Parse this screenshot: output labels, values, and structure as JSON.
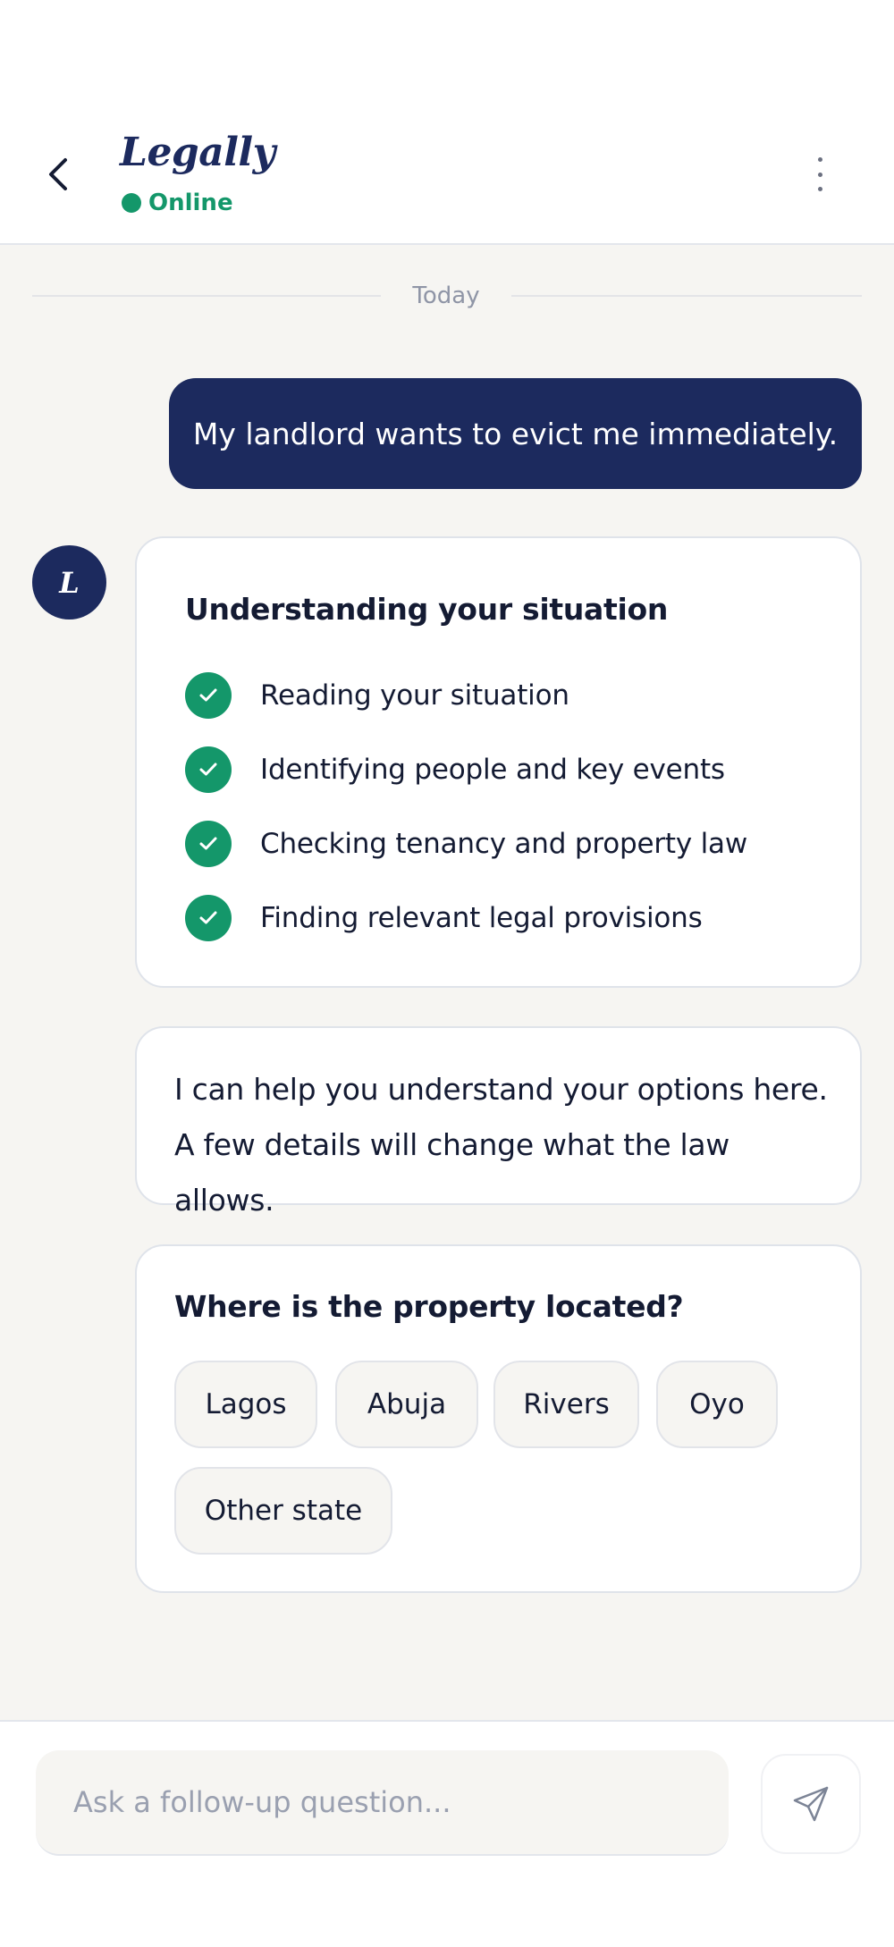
{
  "header": {
    "title": "Legally",
    "status": "Online",
    "back_icon": "chevron-left-icon",
    "menu_icon": "more-vertical-icon"
  },
  "chat": {
    "date_label": "Today",
    "user_message": "My landlord wants to evict me immediately.",
    "avatar_letter": "L",
    "analysis": {
      "title": "Understanding your situation",
      "steps": [
        "Reading your situation",
        "Identifying people and key events",
        "Checking tenancy and property law",
        "Finding relevant legal provisions"
      ]
    },
    "reply_lines": [
      "I can help you understand your options here.",
      "A few details will change what the law allows."
    ],
    "question": {
      "title": "Where is the property located?",
      "options": [
        "Lagos",
        "Abuja",
        "Rivers",
        "Oyo",
        "Other state"
      ]
    }
  },
  "composer": {
    "placeholder": "Ask a follow-up question...",
    "send_icon": "send-icon"
  },
  "colors": {
    "primary": "#1c2a5e",
    "success": "#14976a",
    "background": "#f6f5f2"
  }
}
